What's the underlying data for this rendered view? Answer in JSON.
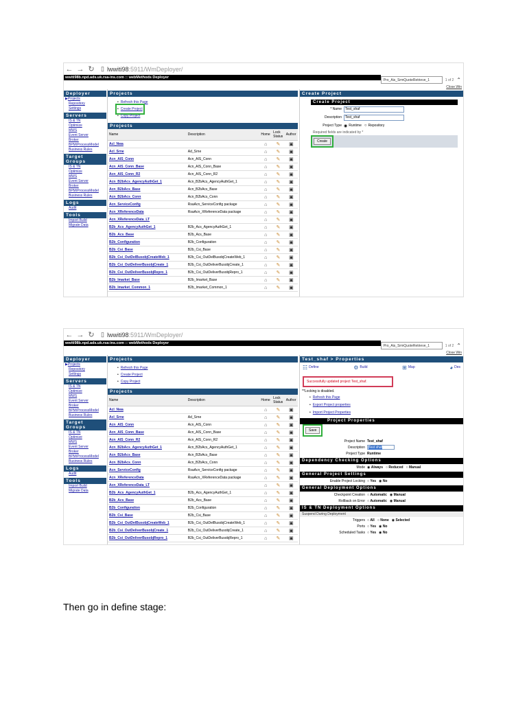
{
  "browser": {
    "url_host": "lwwiti98",
    "url_rest": ":5911/WmDeployer/",
    "find_text": "Pro_Ais_SrmQuoteRetrieve_1",
    "find_count": "1 of 2",
    "close_window": "Close Win",
    "banner": "wwiti98b.npd.ads.uk.rsa-ins.com :: webMethods Deployer"
  },
  "sidebar": {
    "deployer_header": "Deployer",
    "deployer_items": [
      "Projects",
      "Repository",
      "Settings"
    ],
    "servers_header": "Servers",
    "servers_items": [
      "IS & TN",
      "Optimize",
      "MWS",
      "Event Server",
      "Broker",
      "BPM/ProcessModel",
      "Business Rules"
    ],
    "target_header": "Target Groups",
    "target_items": [
      "IS & TN",
      "Optimize",
      "MWS",
      "Event Server",
      "Broker",
      "BPM/ProcessModel",
      "Business Rules"
    ],
    "logs_header": "Logs",
    "logs_items": [
      "Audit"
    ],
    "tools_header": "Tools",
    "tools_items": [
      "Import Build",
      "Migrate Data"
    ]
  },
  "projects_panel": {
    "header": "Projects",
    "links": [
      "Refresh this Page",
      "Create Project",
      "Copy Project"
    ],
    "table_header": "Projects",
    "columns": [
      "Name",
      "Description",
      "Home",
      "Lock Status",
      "Author"
    ]
  },
  "projects_rows_1": [
    {
      "name": "Acl_Nwa",
      "desc": ""
    },
    {
      "name": "Acl_Srne",
      "desc": "Ad_Srne"
    },
    {
      "name": "Acn_AIS_Conn",
      "desc": "Acn_AIS_Conn"
    },
    {
      "name": "Acn_AIS_Conn_Base",
      "desc": "Acn_AIS_Conn_Base"
    },
    {
      "name": "Acn_AIS_Conn_R2",
      "desc": "Acn_AIS_Conn_R2"
    },
    {
      "name": "Acn_B2bAcs_AgencyAuthGet_1",
      "desc": "Acn_B2bAcs_AgencyAuthGet_1"
    },
    {
      "name": "Acn_B2bAcs_Base",
      "desc": "Acn_B2bAcs_Base"
    },
    {
      "name": "Acn_B2bAcs_Conn",
      "desc": "Acn_B2bAcs_Conn"
    },
    {
      "name": "Acn_ServiceConfig",
      "desc": "RsaAcn_ServiceConfig package"
    },
    {
      "name": "Acn_XReferenceData",
      "desc": "RsaAcn_XReferenceData package"
    },
    {
      "name": "Acn_XReferenceData_LT",
      "desc": ""
    },
    {
      "name": "B2b_Acs_AgencyAuthGet_1",
      "desc": "B2b_Acs_AgencyAuthGet_1"
    },
    {
      "name": "B2b_Acs_Base",
      "desc": "B2b_Acs_Base"
    },
    {
      "name": "B2b_Configuration",
      "desc": "B2b_Configuration"
    },
    {
      "name": "B2b_Csi_Base",
      "desc": "B2b_Csi_Base"
    },
    {
      "name": "B2b_Csi_OutDelBusobjCreateWeb_1",
      "desc": "B2b_Csi_OutDelBusobjCreateWeb_1"
    },
    {
      "name": "B2b_Csi_OutDeliverBusobjCreate_1",
      "desc": "B2b_Csi_OutDeliverBusobjCreate_1"
    },
    {
      "name": "B2b_Csi_OutDeliverBusobjRepro_1",
      "desc": "B2b_Csi_OutDeliverBusobjRepro_1"
    },
    {
      "name": "B2b_Imarket_Base",
      "desc": "B2b_Imarket_Base"
    },
    {
      "name": "B2b_Imarket_Common_1",
      "desc": "B2b_Imarket_Common_1"
    }
  ],
  "projects_rows_2": [
    {
      "name": "Acl_Nwa",
      "desc": ""
    },
    {
      "name": "Acl_Srne",
      "desc": "Ad_Srne"
    },
    {
      "name": "Acn_AIS_Conn",
      "desc": "Acn_AIS_Conn"
    },
    {
      "name": "Acn_AIS_Conn_Base",
      "desc": "Acn_AIS_Conn_Base"
    },
    {
      "name": "Acn_AIS_Conn_R2",
      "desc": "Acn_AIS_Conn_R2"
    },
    {
      "name": "Acn_B2bAcs_AgencyAuthGet_1",
      "desc": "Acn_B2bAcs_AgencyAuthGet_1"
    },
    {
      "name": "Acn_B2bAcs_Base",
      "desc": "Acn_B2bAcs_Base"
    },
    {
      "name": "Acn_B2bAcs_Conn",
      "desc": "Acn_B2bAcs_Conn"
    },
    {
      "name": "Acn_ServiceConfig",
      "desc": "RsaAcn_ServiceConfig package"
    },
    {
      "name": "Acn_XReferenceData",
      "desc": "RsaAcn_XReferenceData package"
    },
    {
      "name": "Acn_XReferenceData_LT",
      "desc": ""
    },
    {
      "name": "B2b_Acs_AgencyAuthGet_1",
      "desc": "B2b_Acs_AgencyAuthGet_1"
    },
    {
      "name": "B2b_Acs_Base",
      "desc": "B2b_Acs_Base"
    },
    {
      "name": "B2b_Configuration",
      "desc": "B2b_Configuration"
    },
    {
      "name": "B2b_Csi_Base",
      "desc": "B2b_Csi_Base"
    },
    {
      "name": "B2b_Csi_OutDelBusobjCreateWeb_1",
      "desc": "B2b_Csi_OutDelBusobjCreateWeb_1"
    },
    {
      "name": "B2b_Csi_OutDeliverBusobjCreate_1",
      "desc": "B2b_Csi_OutDeliverBusobjCreate_1"
    },
    {
      "name": "B2b_Csi_OutDeliverBusobjRepro_1",
      "desc": "B2b_Csi_OutDeliverBusobjRepro_1"
    }
  ],
  "create_project": {
    "panel_header": "Create Project",
    "form_header": "Create Project",
    "name_label": "* Name",
    "name_value": "Test_shaf",
    "desc_label": "Description",
    "desc_value": "Test_shaf",
    "type_label": "Project Type",
    "type_runtime": "Runtime",
    "type_repository": "Repository",
    "required_note": "Required fields are indicated by *",
    "create_button": "Create"
  },
  "properties": {
    "panel_header": "Test_shaf > Properties",
    "tab_define": "Define",
    "tab_build": "Build",
    "tab_map": "Map",
    "tab_deploy": "Des",
    "success_message": "Successfully updated project Test_shaf.",
    "locking_note": "**Locking is disabled.",
    "links": [
      "Refresh this Page",
      "Export Project properties",
      "Import Project Properties"
    ],
    "section_header": "Project Properties",
    "save_button": "Save",
    "project_name_label": "Project Name",
    "project_name_value": "Test_shaf",
    "description_label": "Description",
    "description_value": "Test shaf",
    "project_type_label": "Project Type",
    "project_type_value": "Runtime",
    "dep_header": "Dependency Checking Options",
    "mode_label": "Mode",
    "mode_always": "Always",
    "mode_reduced": "Reduced",
    "mode_manual": "Manual",
    "gen_header": "General Project Settings",
    "locking_label": "Enable Project Locking",
    "yes": "Yes",
    "no": "No",
    "deploy_header": "General Deployment Options",
    "checkpoint_label": "Checkpoint Creation",
    "rollback_label": "Rollback on Error",
    "automatic": "Automatic",
    "manual": "Manual",
    "istn_header": "IS & TN Deployment Options",
    "suspend_label": "Suspend During Deployment",
    "triggers_label": "Triggers",
    "all": "All",
    "none": "None",
    "selected": "Selected",
    "ports_label": "Ports",
    "scheduled_label": "Scheduled Tasks"
  },
  "caption": "Then go in define stage:"
}
